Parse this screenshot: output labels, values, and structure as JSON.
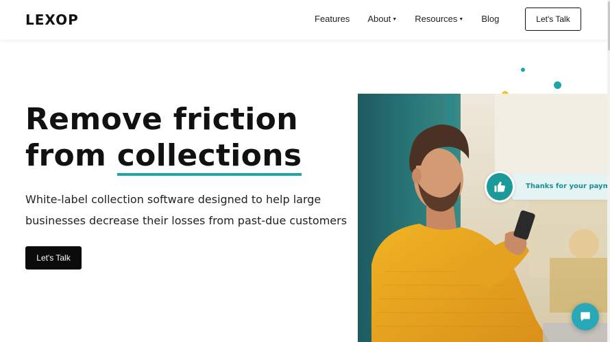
{
  "header": {
    "logo": "LEXOP",
    "nav": [
      {
        "label": "Features",
        "has_dropdown": false
      },
      {
        "label": "About",
        "has_dropdown": true
      },
      {
        "label": "Resources",
        "has_dropdown": true
      },
      {
        "label": "Blog",
        "has_dropdown": false
      }
    ],
    "cta_label": "Let's Talk"
  },
  "hero": {
    "title_line1": "Remove friction",
    "title_line2_prefix": "from ",
    "title_line2_highlight": "collections",
    "subtitle_line1": "White-label collection software designed to help large",
    "subtitle_line2": "businesses decrease their losses from past-due customers",
    "cta_label": "Let's Talk"
  },
  "notification": {
    "icon": "thumbs-up-icon",
    "text": "Thanks for your payment"
  },
  "chat": {
    "icon": "chat-bubble-icon"
  },
  "colors": {
    "accent": "#1ea6a6",
    "dark": "#0b0b0b",
    "yellow": "#e8c832"
  }
}
